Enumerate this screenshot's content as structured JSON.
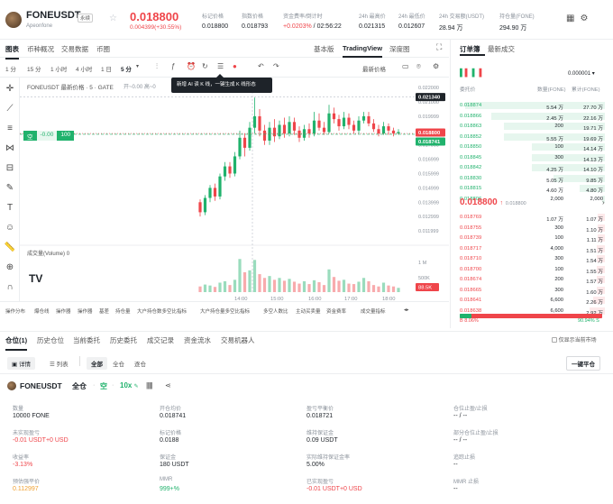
{
  "header": {
    "symbol": "FONEUSDT",
    "tag": "永续",
    "subtitle": "Apeonfone",
    "price": "0.018800",
    "change": "0.004399(+30.55%)",
    "stats": [
      {
        "label": "标记价格",
        "value": "0.018800",
        "color": "#1e2329"
      },
      {
        "label": "指数价格",
        "value": "0.018793",
        "color": "#1e2329"
      },
      {
        "label": "资金费率/倒计时",
        "value": "+0.0203%",
        "value2": " / 02:56:22",
        "color": "#ef454a"
      },
      {
        "label": "24h 最高价",
        "value": "0.021315",
        "color": "#1e2329"
      },
      {
        "label": "24h 最低价",
        "value": "0.012607",
        "color": "#1e2329"
      },
      {
        "label": "24h 交易额(USDT)",
        "value": "28.94 万",
        "color": "#1e2329"
      },
      {
        "label": "持仓量(FONE)",
        "value": "294.90 万",
        "color": "#1e2329"
      }
    ]
  },
  "chart_tabs": {
    "left": [
      "图表",
      "币种概况",
      "交易数据",
      "币圈"
    ],
    "right": [
      "基本版",
      "TradingView",
      "深度图"
    ]
  },
  "toolbar": {
    "intervals": [
      "1 分",
      "15 分",
      "1 小时",
      "4 小时",
      "1 日",
      "5 分"
    ],
    "price_mode": "最新价格"
  },
  "chart": {
    "legend": "FONEUSDT 最新价格 · 5 · GATE",
    "legend_ohlc": "开~0.00  高~0",
    "pos_label": "空",
    "pos_value": "-0.00",
    "pos_qty": "100",
    "tooltip": "新增 AI 读 K 线，一键生成 K 线形态",
    "volume_label": "成交量(Volume)",
    "volume_val": "0",
    "crosshair_price": "0.021340",
    "last_price": "0.018800",
    "pos_price": "0.018741",
    "vol_tag": "88.5K",
    "y_ticks": [
      "0.022000",
      "0.021000",
      "0.019999",
      "0.018999",
      "0.017999",
      "0.016999",
      "0.015999",
      "0.014999",
      "0.013999",
      "0.012999",
      "0.011999"
    ],
    "vol_ticks": [
      "1 M",
      "500K"
    ],
    "x_ticks": [
      "14:00",
      "15:00",
      "16:00",
      "17:00",
      "18:00"
    ]
  },
  "indicators": [
    "操作分布",
    "爆仓线",
    "操作器",
    "操作器",
    "基差",
    "持仓量",
    "大户持仓数多空比指标",
    "大户持仓量多空比指标",
    "多空人数比",
    "主动买卖量",
    "资金费率",
    "成交量指标"
  ],
  "orderbook": {
    "tabs": [
      "订单簿",
      "最新成交"
    ],
    "precision": "0.000001",
    "cols": [
      "委托价",
      "数量(FONE)",
      "累计(FONE)"
    ],
    "bids": [
      {
        "p": "0.018874",
        "q": "5.54 万",
        "t": "27.70 万",
        "w": 0.98
      },
      {
        "p": "0.018866",
        "q": "2.45 万",
        "t": "22.16 万",
        "w": 0.8
      },
      {
        "p": "0.018863",
        "q": "200",
        "t": "19.71 万",
        "w": 0.71
      },
      {
        "p": "0.018852",
        "q": "5.55 万",
        "t": "19.69 万",
        "w": 0.71
      },
      {
        "p": "0.018850",
        "q": "100",
        "t": "14.14 万",
        "w": 0.51
      },
      {
        "p": "0.018845",
        "q": "300",
        "t": "14.13 万",
        "w": 0.51
      },
      {
        "p": "0.018842",
        "q": "4.25 万",
        "t": "14.10 万",
        "w": 0.51
      },
      {
        "p": "0.018830",
        "q": "5.05 万",
        "t": "9.85 万",
        "w": 0.36
      },
      {
        "p": "0.018815",
        "q": "4.60 万",
        "t": "4.80 万",
        "w": 0.18
      },
      {
        "p": "0.018806",
        "q": "2,000",
        "t": "2,000",
        "w": 0.02
      }
    ],
    "last_price": "0.018800",
    "last_mark": "0.018800",
    "asks": [
      {
        "p": "0.018769",
        "q": "1.07 万",
        "t": "1.07 万",
        "w": 0.05
      },
      {
        "p": "0.018755",
        "q": "300",
        "t": "1.10 万",
        "w": 0.05
      },
      {
        "p": "0.018739",
        "q": "100",
        "t": "1.11 万",
        "w": 0.05
      },
      {
        "p": "0.018717",
        "q": "4,000",
        "t": "1.51 万",
        "w": 0.06
      },
      {
        "p": "0.018710",
        "q": "300",
        "t": "1.54 万",
        "w": 0.06
      },
      {
        "p": "0.018700",
        "q": "100",
        "t": "1.55 万",
        "w": 0.06
      },
      {
        "p": "0.018674",
        "q": "200",
        "t": "1.57 万",
        "w": 0.06
      },
      {
        "p": "0.018665",
        "q": "300",
        "t": "1.60 万",
        "w": 0.06
      },
      {
        "p": "0.018641",
        "q": "6,600",
        "t": "2.26 万",
        "w": 0.08
      },
      {
        "p": "0.018638",
        "q": "6,600",
        "t": "2.92 万",
        "w": 0.11
      }
    ],
    "ratio_buy": "8.06%",
    "ratio_sell": "90.94%",
    "ratio_buy_frac": 0.0806
  },
  "positions": {
    "tabs": [
      "仓位(1)",
      "历史仓位",
      "当前委托",
      "历史委托",
      "成交记录",
      "资金流水",
      "交易机器人"
    ],
    "only_current": "仅显示当前市场",
    "view_modes": [
      "详情",
      "列表"
    ],
    "filters": [
      "全部",
      "全仓",
      "逐仓"
    ],
    "close_all": "一键平仓",
    "row_symbol": "FONEUSDT",
    "row_mode": "全仓",
    "row_side": "空",
    "row_leverage": "10x",
    "fields": [
      {
        "l": "数量",
        "v": "10000 FONE",
        "c": "#1e2329"
      },
      {
        "l": "开仓均价",
        "v": "0.018741",
        "c": "#1e2329"
      },
      {
        "l": "盈亏平衡价",
        "v": "0.018721",
        "c": "#1e2329"
      },
      {
        "l": "仓位止盈/止损",
        "v": "-- / --",
        "c": "#1e2329"
      },
      {
        "l": "未实现盈亏",
        "v": "-0.01 USDT+0 USD",
        "c": "#ef454a"
      },
      {
        "l": "标记价格",
        "v": "0.0188",
        "c": "#1e2329"
      },
      {
        "l": "维持保证金",
        "v": "0.09 USDT",
        "c": "#1e2329"
      },
      {
        "l": "部分仓位止盈/止损",
        "v": "-- / --",
        "c": "#1e2329"
      },
      {
        "l": "收益率",
        "v": "-3.13%",
        "c": "#ef454a"
      },
      {
        "l": "保证金",
        "v": "180 USDT",
        "c": "#1e2329"
      },
      {
        "l": "实际维持保证金率",
        "v": "5.00%",
        "c": "#1e2329"
      },
      {
        "l": "追踪止损",
        "v": "--",
        "c": "#1e2329"
      },
      {
        "l": "预估强平价",
        "v": "0.112997",
        "c": "#f0a030"
      },
      {
        "l": "MMR",
        "v": "999+%",
        "c": "#20b26c"
      },
      {
        "l": "已实现盈亏",
        "v": "-0.01 USDT+0 USD",
        "c": "#ef454a"
      },
      {
        "l": "MMR 止损",
        "v": "--",
        "c": "#1e2329"
      }
    ]
  },
  "colors": {
    "up": "#20b26c",
    "down": "#ef454a",
    "accent": "#1e2329"
  },
  "chart_data": {
    "type": "candlestick",
    "x_ticks": [
      "14:00",
      "15:00",
      "16:00",
      "17:00",
      "18:00"
    ],
    "ylim": [
      0.0115,
      0.0222
    ],
    "candles": [
      [
        0.014,
        0.0133,
        0.0142,
        0.013,
        120
      ],
      [
        0.0133,
        0.0143,
        0.0145,
        0.0131,
        160
      ],
      [
        0.0143,
        0.015,
        0.0152,
        0.014,
        140
      ],
      [
        0.015,
        0.0144,
        0.0153,
        0.0141,
        110
      ],
      [
        0.0144,
        0.0158,
        0.016,
        0.0142,
        200
      ],
      [
        0.0158,
        0.0165,
        0.0168,
        0.0155,
        230
      ],
      [
        0.0165,
        0.016,
        0.0168,
        0.0157,
        150
      ],
      [
        0.016,
        0.0172,
        0.0175,
        0.0158,
        260
      ],
      [
        0.0172,
        0.0185,
        0.019,
        0.017,
        700
      ],
      [
        0.0185,
        0.0178,
        0.0188,
        0.0172,
        420
      ],
      [
        0.0178,
        0.0192,
        0.0196,
        0.0176,
        460
      ],
      [
        0.0192,
        0.02,
        0.0213,
        0.0188,
        680
      ],
      [
        0.02,
        0.019,
        0.0205,
        0.0186,
        380
      ],
      [
        0.019,
        0.0183,
        0.0194,
        0.018,
        300
      ],
      [
        0.0183,
        0.0192,
        0.0196,
        0.018,
        340
      ],
      [
        0.0192,
        0.0186,
        0.0198,
        0.0182,
        260
      ],
      [
        0.0186,
        0.0194,
        0.0197,
        0.0184,
        300
      ],
      [
        0.0194,
        0.0188,
        0.0199,
        0.0185,
        240
      ],
      [
        0.0188,
        0.0196,
        0.02,
        0.0186,
        280
      ],
      [
        0.0196,
        0.019,
        0.0199,
        0.0187,
        220
      ],
      [
        0.019,
        0.0185,
        0.0193,
        0.0182,
        180
      ],
      [
        0.0185,
        0.0191,
        0.0194,
        0.0183,
        230
      ],
      [
        0.0191,
        0.0188,
        0.0195,
        0.0185,
        170
      ],
      [
        0.0188,
        0.0197,
        0.0203,
        0.0186,
        250
      ],
      [
        0.0197,
        0.0192,
        0.0202,
        0.019,
        210
      ],
      [
        0.0192,
        0.0189,
        0.0196,
        0.0187,
        150
      ],
      [
        0.0189,
        0.0202,
        0.0208,
        0.0188,
        480
      ],
      [
        0.0202,
        0.0198,
        0.0206,
        0.0195,
        320
      ],
      [
        0.0198,
        0.0193,
        0.0201,
        0.019,
        240
      ],
      [
        0.0193,
        0.0199,
        0.0203,
        0.0191,
        260
      ],
      [
        0.0199,
        0.0194,
        0.0202,
        0.0191,
        180
      ],
      [
        0.0194,
        0.019,
        0.0197,
        0.0188,
        170
      ],
      [
        0.019,
        0.0197,
        0.02,
        0.0188,
        220
      ],
      [
        0.0197,
        0.02,
        0.0203,
        0.0195,
        300
      ],
      [
        0.02,
        0.0195,
        0.0203,
        0.0193,
        230
      ],
      [
        0.0195,
        0.0191,
        0.0198,
        0.0189,
        150
      ],
      [
        0.0191,
        0.0188,
        0.0194,
        0.0186,
        120
      ],
      [
        0.0188,
        0.0193,
        0.0196,
        0.0187,
        200
      ],
      [
        0.0193,
        0.019,
        0.0195,
        0.0187,
        140
      ],
      [
        0.019,
        0.0188,
        0.0192,
        0.0186,
        120
      ],
      [
        0.0188,
        0.0189,
        0.0191,
        0.0187,
        90
      ]
    ]
  }
}
